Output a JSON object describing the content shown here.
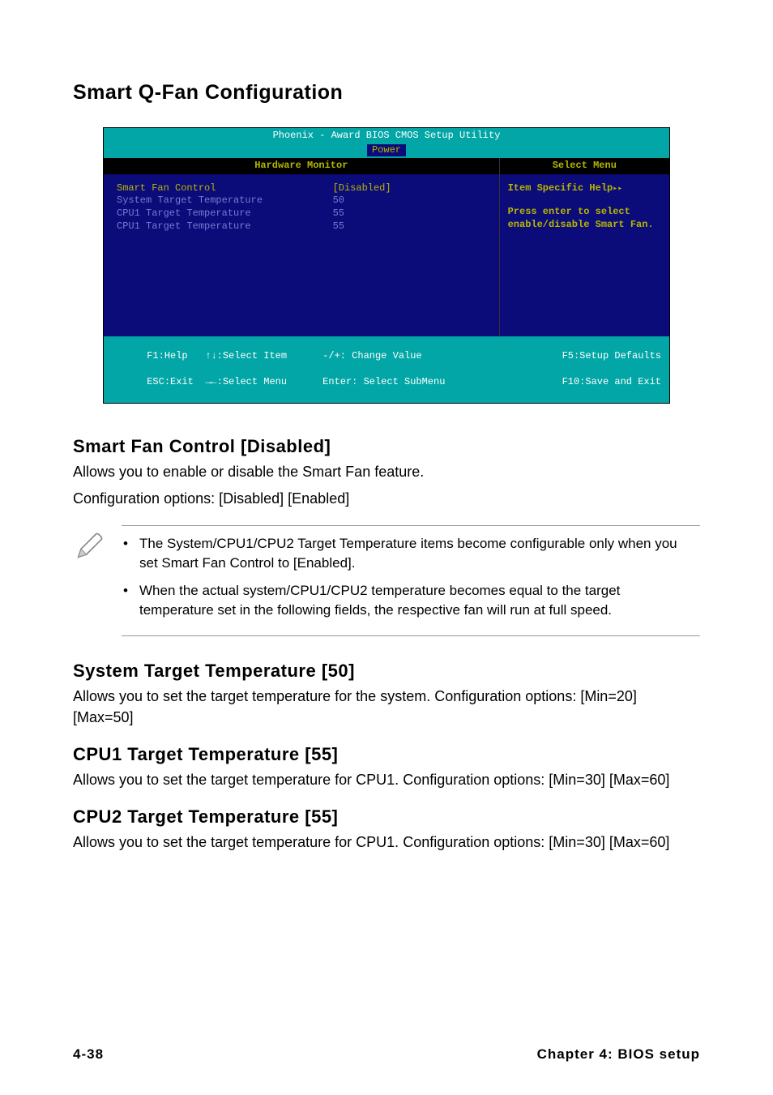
{
  "section_title": "Smart Q-Fan Configuration",
  "bios": {
    "title": "Phoenix - Award BIOS CMOS Setup Utility",
    "tab": "Power",
    "left_header": "Hardware Monitor",
    "right_header": "Select Menu",
    "rows": [
      {
        "label": "Smart Fan Control",
        "value": "[Disabled]"
      },
      {
        "label": "System Target Temperature",
        "value": "50"
      },
      {
        "label": "CPU1 Target Temperature",
        "value": "55"
      },
      {
        "label": "CPU1 Target Temperature",
        "value": "55"
      }
    ],
    "help_title": "Item Specific Help",
    "help_line1": "Press enter to select",
    "help_line2": "enable/disable Smart Fan.",
    "footer": {
      "f1": "F1:Help",
      "select_item": "↑↓:Select Item",
      "change_value": "-/+: Change Value",
      "setup_defaults": "F5:Setup Defaults",
      "esc": "ESC:Exit",
      "select_menu": "→←:Select Menu",
      "select_submenu": "Enter: Select SubMenu",
      "save_exit": "F10:Save and Exit"
    }
  },
  "sections": {
    "sfc": {
      "heading": "Smart Fan Control [Disabled]",
      "p1": "Allows you to enable or disable the Smart Fan feature.",
      "p2": "Configuration options: [Disabled] [Enabled]"
    },
    "notes": {
      "n1": "The System/CPU1/CPU2 Target Temperature items become configurable only when you set Smart Fan Control to [Enabled].",
      "n2": "When the actual system/CPU1/CPU2 temperature becomes equal to the target temperature set in the following fields, the respective fan will run at full speed."
    },
    "stt": {
      "heading": "System Target Temperature [50]",
      "p": "Allows you to set the target temperature for the system. Configuration options: [Min=20] [Max=50]"
    },
    "c1t": {
      "heading": "CPU1 Target Temperature [55]",
      "p": "Allows you to set the target temperature for CPU1. Configuration options: [Min=30] [Max=60]"
    },
    "c2t": {
      "heading": "CPU2 Target Temperature [55]",
      "p": "Allows you to set the target temperature for CPU1. Configuration options: [Min=30] [Max=60]"
    }
  },
  "footer": {
    "left": "4-38",
    "right": "Chapter 4: BIOS setup"
  }
}
